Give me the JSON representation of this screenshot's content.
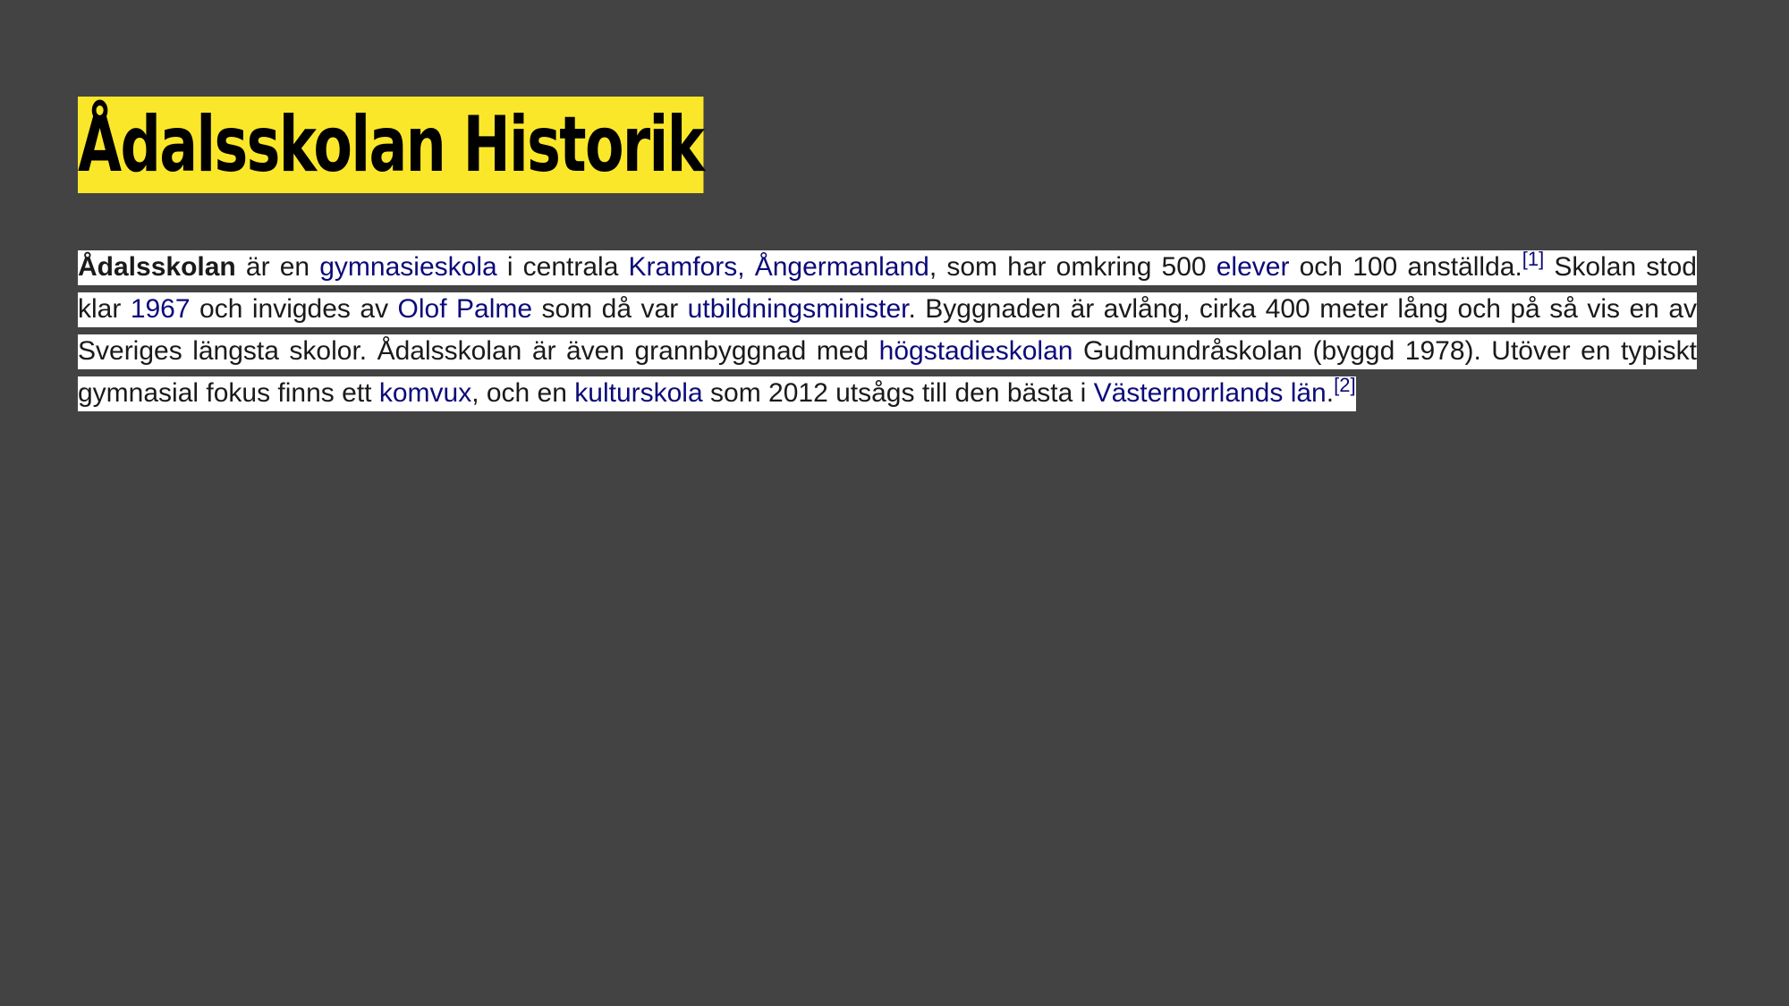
{
  "title": "Ådalsskolan Historik",
  "paragraph": {
    "bold_name": "Ådalsskolan",
    "t1": " är en ",
    "l_gymnasieskola": "gymnasieskola",
    "t2": " i centrala ",
    "l_kramfors": "Kramfors, Ångermanland",
    "t3": ", som har omkring 500 ",
    "l_elever": "elever",
    "t4": " och 100 anställda.",
    "ref1": "[1]",
    "t5": " Skolan stod klar ",
    "l_1967": "1967",
    "t6": " och invigdes av ",
    "l_palme": "Olof Palme",
    "t7": " som då var ",
    "l_minister": "utbildningsminister",
    "t8": ". Byggnaden är avlång, cirka 400 meter lång och på så vis en av Sveriges längsta skolor. Ådalsskolan är även grannbyggnad med ",
    "l_hogstadie": "högstadieskolan",
    "t9": " Gudmundråskolan (byggd 1978). Utöver en typiskt gymnasial fokus finns ett ",
    "l_komvux": "komvux",
    "t10": ", och en ",
    "l_kulturskola": "kulturskola",
    "t11": " som 2012 utsågs till den bästa i ",
    "l_vasternorrland": "Västernorrlands län",
    "t12": ".",
    "ref2": "[2]"
  },
  "colors": {
    "background": "#434343",
    "title_highlight": "#fbe72a",
    "text_highlight": "#ffffff",
    "link": "#0c0a7a"
  }
}
